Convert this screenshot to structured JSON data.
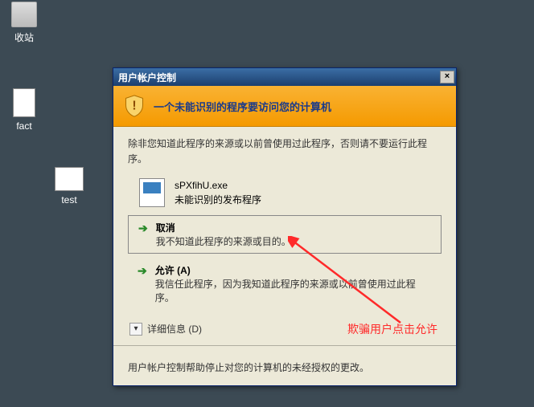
{
  "desktop": {
    "trash_label": "收站",
    "fact_label": "fact",
    "test_label": "test"
  },
  "dialog": {
    "title": "用户帐户控制",
    "close": "×",
    "banner": "一个未能识别的程序要访问您的计算机",
    "body_text": "除非您知道此程序的来源或以前曾使用过此程序，否则请不要运行此程序。",
    "program": {
      "name": "sPXfihU.exe",
      "publisher": "未能识别的发布程序"
    },
    "cancel": {
      "title": "取消",
      "desc": "我不知道此程序的来源或目的。"
    },
    "allow": {
      "title": "允许 (A)",
      "desc": "我信任此程序，因为我知道此程序的来源或以前曾使用过此程序。"
    },
    "details": "详细信息 (D)",
    "footer": "用户帐户控制帮助停止对您的计算机的未经授权的更改。"
  },
  "annotation": "欺骗用户点击允许"
}
